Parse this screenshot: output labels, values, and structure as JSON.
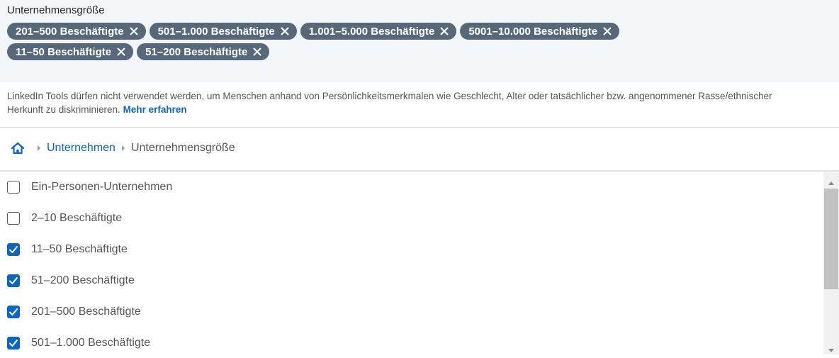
{
  "filter": {
    "title": "Unternehmensgröße",
    "chips_row1": [
      "201–500 Beschäftigte",
      "501–1.000 Beschäftigte",
      "1.001–5.000 Beschäftigte",
      "5001–10.000 Beschäftigte"
    ],
    "chips_row2": [
      "11–50 Beschäftigte",
      "51–200 Beschäftigte"
    ]
  },
  "notice": {
    "text": "LinkedIn Tools dürfen nicht verwendet werden, um Menschen anhand von Persönlichkeitsmerkmalen wie Geschlecht, Alter oder tatsächlicher bzw. angenommener Rasse/ethnischer Herkunft zu diskriminieren. ",
    "link": "Mehr erfahren"
  },
  "breadcrumb": {
    "home_icon": "home-icon",
    "level1": "Unternehmen",
    "level2": "Unternehmensgröße"
  },
  "options": [
    {
      "label": "Ein-Personen-Unternehmen",
      "checked": false
    },
    {
      "label": "2–10 Beschäftigte",
      "checked": false
    },
    {
      "label": "11–50 Beschäftigte",
      "checked": true
    },
    {
      "label": "51–200 Beschäftigte",
      "checked": true
    },
    {
      "label": "201–500 Beschäftigte",
      "checked": true
    },
    {
      "label": "501–1.000 Beschäftigte",
      "checked": true
    }
  ],
  "colors": {
    "chip_bg": "#56687a",
    "accent": "#0a66c2",
    "top_bg": "#f3f6f8"
  }
}
